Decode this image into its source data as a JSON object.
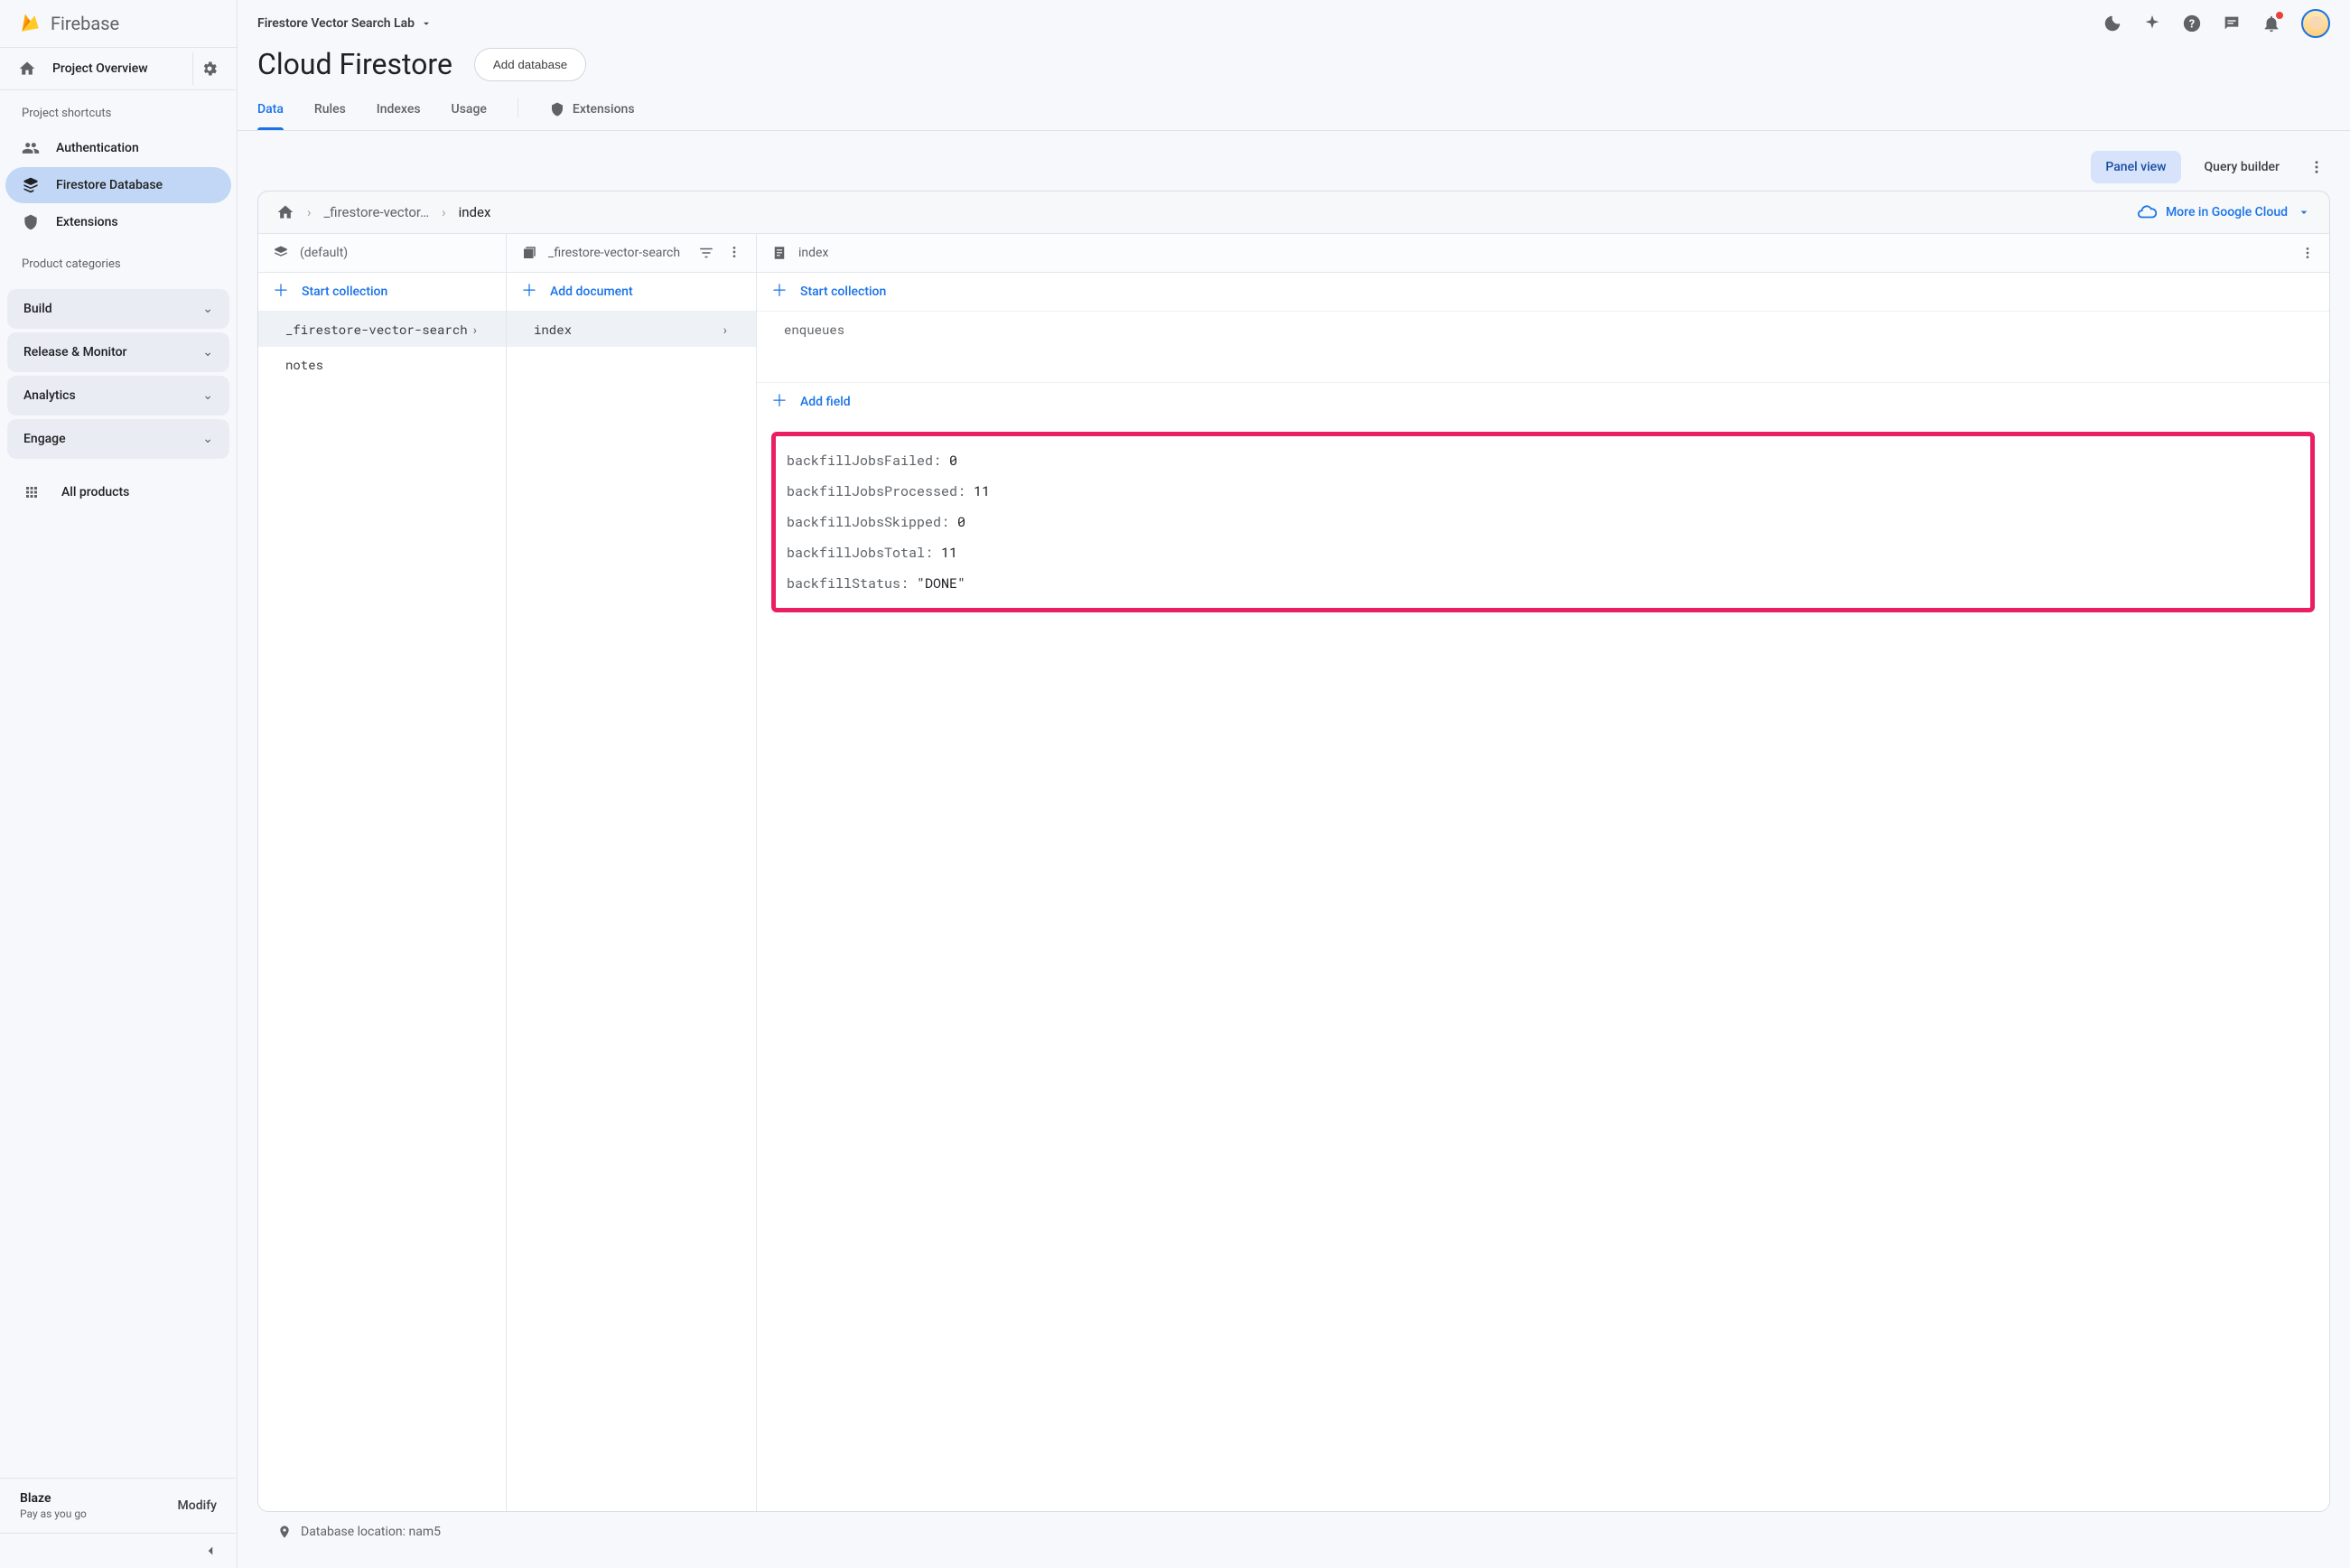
{
  "brand": "Firebase",
  "project_name": "Firestore Vector Search Lab",
  "page_title": "Cloud Firestore",
  "add_database_label": "Add database",
  "sidebar": {
    "overview_label": "Project Overview",
    "shortcuts_label": "Project shortcuts",
    "items": [
      {
        "label": "Authentication"
      },
      {
        "label": "Firestore Database"
      },
      {
        "label": "Extensions"
      }
    ],
    "categories_label": "Product categories",
    "categories": [
      {
        "label": "Build"
      },
      {
        "label": "Release & Monitor"
      },
      {
        "label": "Analytics"
      },
      {
        "label": "Engage"
      }
    ],
    "all_products_label": "All products",
    "plan": {
      "name": "Blaze",
      "sub": "Pay as you go",
      "modify": "Modify"
    }
  },
  "tabs": [
    {
      "label": "Data",
      "active": true
    },
    {
      "label": "Rules"
    },
    {
      "label": "Indexes"
    },
    {
      "label": "Usage"
    }
  ],
  "extensions_tab": "Extensions",
  "view": {
    "panel": "Panel view",
    "query": "Query builder"
  },
  "crumbs": {
    "c1": "_firestore-vector…",
    "c2": "index"
  },
  "gcloud_label": "More in Google Cloud",
  "col1": {
    "header": "(default)",
    "action": "Start collection",
    "items": [
      {
        "label": "_firestore-vector-search",
        "active": true
      },
      {
        "label": "notes"
      }
    ]
  },
  "col2": {
    "header": "_firestore-vector-search",
    "action": "Add document",
    "items": [
      {
        "label": "index",
        "active": true
      }
    ]
  },
  "col3": {
    "header": "index",
    "action": "Start collection",
    "sub": "enqueues",
    "action2": "Add field",
    "fields": [
      {
        "k": "backfillJobsFailed",
        "v": "0"
      },
      {
        "k": "backfillJobsProcessed",
        "v": "11"
      },
      {
        "k": "backfillJobsSkipped",
        "v": "0"
      },
      {
        "k": "backfillJobsTotal",
        "v": "11"
      },
      {
        "k": "backfillStatus",
        "v": "\"DONE\""
      }
    ]
  },
  "footer": {
    "label": "Database location: nam5"
  }
}
